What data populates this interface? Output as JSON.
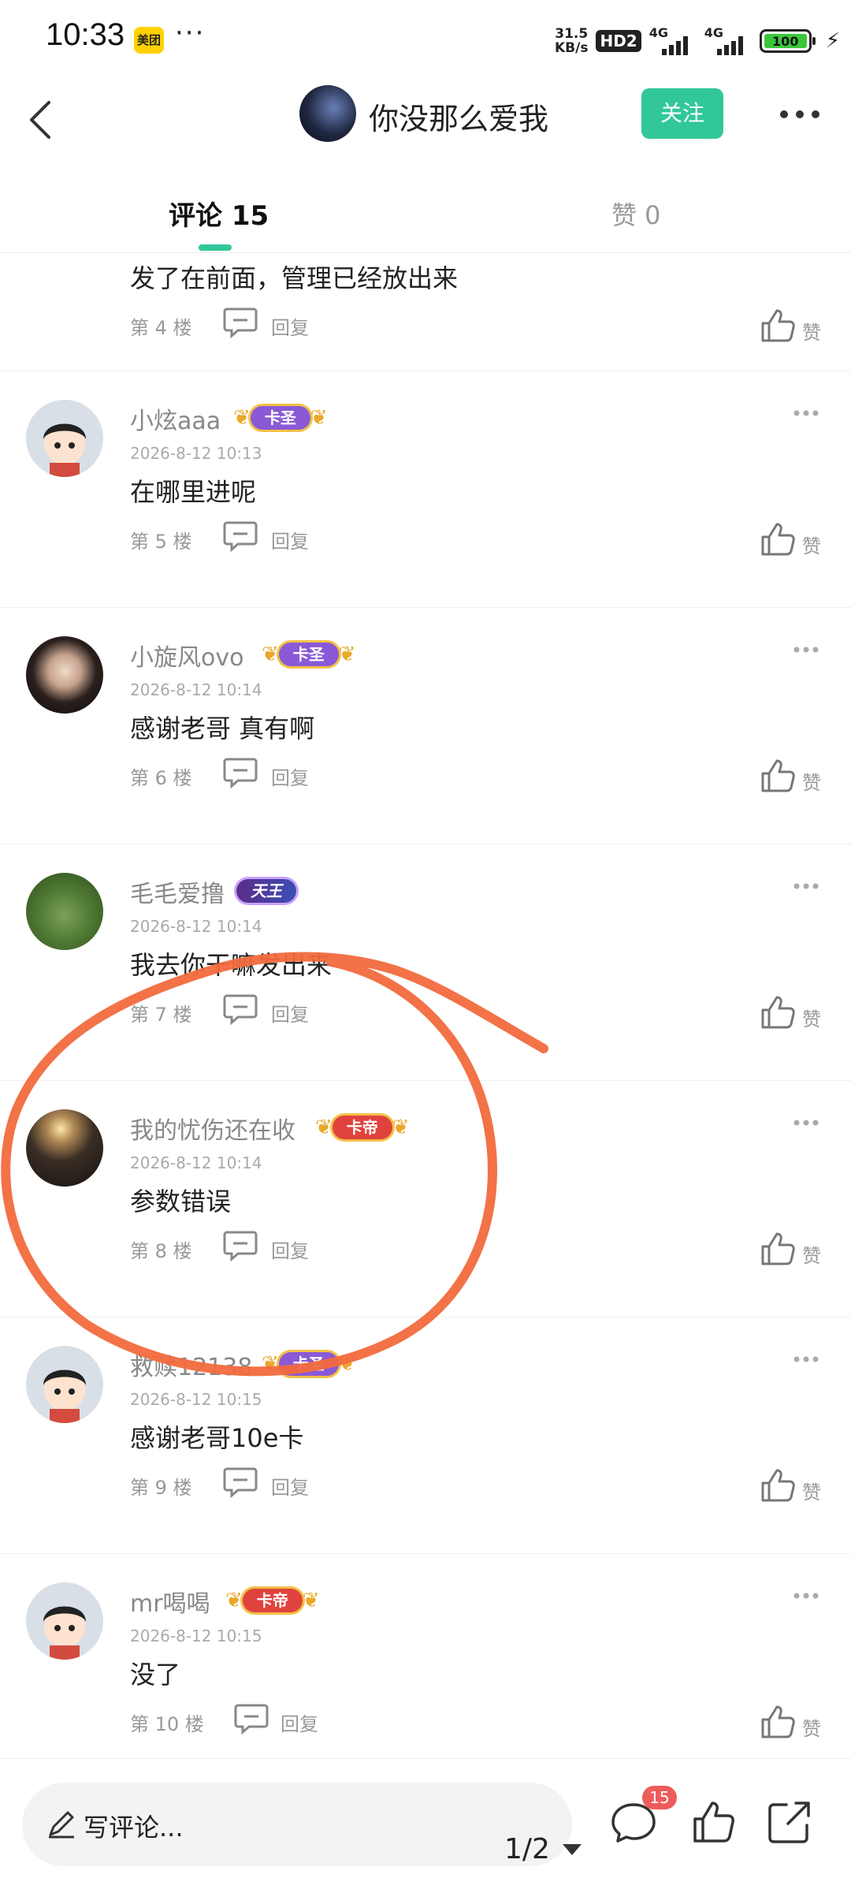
{
  "status_bar": {
    "time": "10:33",
    "app_badge": "美团",
    "more": "···",
    "net_speed": "31.5\nKB/s",
    "hd": "HD2",
    "network_1": "4G",
    "network_2": "4G",
    "battery": "100"
  },
  "header": {
    "title": "你没那么爱我",
    "follow_label": "关注"
  },
  "tabs": {
    "comments": "评论 15",
    "likes": "赞 0"
  },
  "comments": [
    {
      "username": "",
      "badge": "",
      "date": "",
      "content": "发了在前面，管理已经放出来",
      "floor": "第 4 楼",
      "reply": "回复",
      "like": "赞"
    },
    {
      "username": "小炫aaa",
      "badge": "卡圣",
      "date": "2026-8-12 10:13",
      "content": "在哪里进呢",
      "floor": "第 5 楼",
      "reply": "回复",
      "like": "赞"
    },
    {
      "username": "小旋风ovo",
      "badge": "卡圣",
      "date": "2026-8-12 10:14",
      "content": "感谢老哥 真有啊",
      "floor": "第 6 楼",
      "reply": "回复",
      "like": "赞"
    },
    {
      "username": "毛毛爱撸",
      "badge": "天王",
      "date": "2026-8-12 10:14",
      "content": "我去你干嘛发出来",
      "floor": "第 7 楼",
      "reply": "回复",
      "like": "赞"
    },
    {
      "username": "我的忧伤还在收",
      "badge": "卡帝",
      "date": "2026-8-12 10:14",
      "content": "参数错误",
      "floor": "第 8 楼",
      "reply": "回复",
      "like": "赞"
    },
    {
      "username": "救赎12138",
      "badge": "卡圣",
      "date": "2026-8-12 10:15",
      "content": "感谢老哥10e卡",
      "floor": "第 9 楼",
      "reply": "回复",
      "like": "赞"
    },
    {
      "username": "mr喝喝",
      "badge": "卡帝",
      "date": "2026-8-12 10:15",
      "content": "没了",
      "floor": "第 10 楼",
      "reply": "回复",
      "like": "赞"
    }
  ],
  "bottom_bar": {
    "write_placeholder": "写评论...",
    "pager": "1/2",
    "comment_count": "15"
  },
  "colors": {
    "accent": "#31c79a",
    "annotation": "#f26a3d",
    "badge_saint": "#8a59d6",
    "badge_emperor": "#e0433d"
  }
}
